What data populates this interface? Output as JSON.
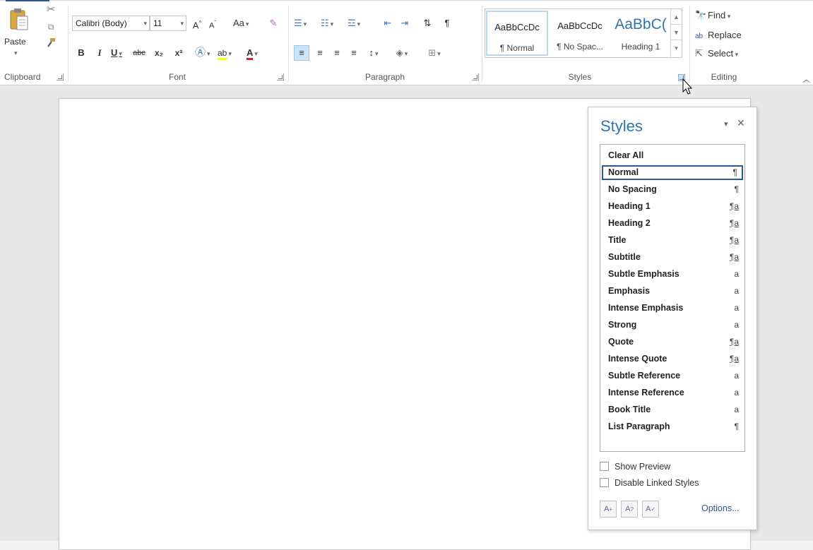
{
  "ribbon": {
    "clipboard": {
      "label": "Clipboard",
      "paste_label": "Paste"
    },
    "font": {
      "label": "Font",
      "font_name": "Calibri (Body)",
      "font_size": "11",
      "grow": "A",
      "shrink": "A",
      "change_case": "Aa",
      "bold": "B",
      "italic": "I",
      "underline": "U",
      "strike": "abc",
      "subscript": "x₂",
      "superscript": "x²"
    },
    "paragraph": {
      "label": "Paragraph",
      "show_marks": "¶"
    },
    "styles": {
      "label": "Styles",
      "gallery": [
        {
          "sample": "AaBbCcDc",
          "name": "¶ Normal"
        },
        {
          "sample": "AaBbCcDc",
          "name": "¶ No Spac..."
        },
        {
          "sample": "AaBbC(",
          "name": "Heading 1"
        }
      ]
    },
    "editing": {
      "label": "Editing",
      "find": "Find",
      "replace": "Replace",
      "select": "Select"
    }
  },
  "styles_pane": {
    "title": "Styles",
    "items": [
      {
        "label": "Clear All",
        "glyph": ""
      },
      {
        "label": "Normal",
        "glyph": "¶"
      },
      {
        "label": "No Spacing",
        "glyph": "¶"
      },
      {
        "label": "Heading 1",
        "glyph": "¶a"
      },
      {
        "label": "Heading 2",
        "glyph": "¶a"
      },
      {
        "label": "Title",
        "glyph": "¶a"
      },
      {
        "label": "Subtitle",
        "glyph": "¶a"
      },
      {
        "label": "Subtle Emphasis",
        "glyph": "a"
      },
      {
        "label": "Emphasis",
        "glyph": "a"
      },
      {
        "label": "Intense Emphasis",
        "glyph": "a"
      },
      {
        "label": "Strong",
        "glyph": "a"
      },
      {
        "label": "Quote",
        "glyph": "¶a"
      },
      {
        "label": "Intense Quote",
        "glyph": "¶a"
      },
      {
        "label": "Subtle Reference",
        "glyph": "a"
      },
      {
        "label": "Intense Reference",
        "glyph": "a"
      },
      {
        "label": "Book Title",
        "glyph": "a"
      },
      {
        "label": "List Paragraph",
        "glyph": "¶"
      }
    ],
    "selected_item": "Normal",
    "show_preview": "Show Preview",
    "disable_linked": "Disable Linked Styles",
    "options": "Options..."
  }
}
